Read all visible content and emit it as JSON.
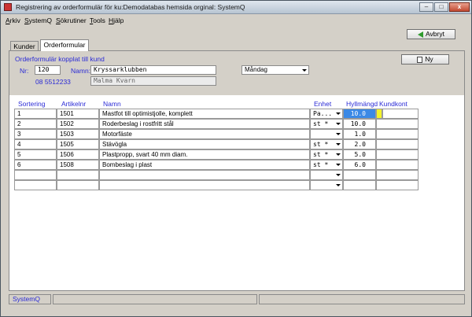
{
  "window": {
    "title": "Registrering av orderformulär för ku:Demodatabas hemsida orginal: SystemQ",
    "min": "–",
    "max": "□",
    "close": "x"
  },
  "menu": [
    "Arkiv",
    "SystemQ",
    "Sökrutiner",
    "Tools",
    "Hjälp"
  ],
  "toolbar": {
    "cancel_label": "Avbryt"
  },
  "tabs": [
    {
      "label": "Kunder",
      "active": false
    },
    {
      "label": "Orderformular",
      "active": true
    }
  ],
  "form": {
    "group_title": "Orderformulär kopplat till kund",
    "nr_label": "Nr:",
    "nr_value": "120",
    "name_label": "Namn:",
    "name_value": "Kryssarklubben",
    "phone": "08 5512233",
    "city": "Malma Kvarn",
    "day_select": "Måndag",
    "new_button": "Ny"
  },
  "table": {
    "headers": [
      "Sortering",
      "Artikelnr",
      "Namn",
      "Enhet",
      "Hyllmängd",
      "Kundkont"
    ],
    "rows": [
      {
        "sort": "1",
        "art": "1501",
        "name": "Mastfot till optimistjolle, komplett",
        "unit": "Pa...",
        "qty": "10.0",
        "kund": ""
      },
      {
        "sort": "2",
        "art": "1502",
        "name": "Roderbeslag  i rostfritt stål",
        "unit": "st *",
        "qty": "10.0",
        "kund": ""
      },
      {
        "sort": "3",
        "art": "1503",
        "name": "Motorfäste",
        "unit": "",
        "qty": "1.0",
        "kund": ""
      },
      {
        "sort": "4",
        "art": "1505",
        "name": "Stävögla",
        "unit": "st *",
        "qty": "2.0",
        "kund": ""
      },
      {
        "sort": "5",
        "art": "1506",
        "name": "Plastpropp, svart 40 mm diam.",
        "unit": "st *",
        "qty": "5.0",
        "kund": ""
      },
      {
        "sort": "6",
        "art": "1508",
        "name": "Bombeslag i plast",
        "unit": "st *",
        "qty": "6.0",
        "kund": ""
      },
      {
        "sort": "",
        "art": "",
        "name": "",
        "unit": "",
        "qty": "",
        "kund": ""
      },
      {
        "sort": "",
        "art": "",
        "name": "",
        "unit": "",
        "qty": "",
        "kund": ""
      }
    ]
  },
  "status": {
    "app": "SystemQ"
  }
}
